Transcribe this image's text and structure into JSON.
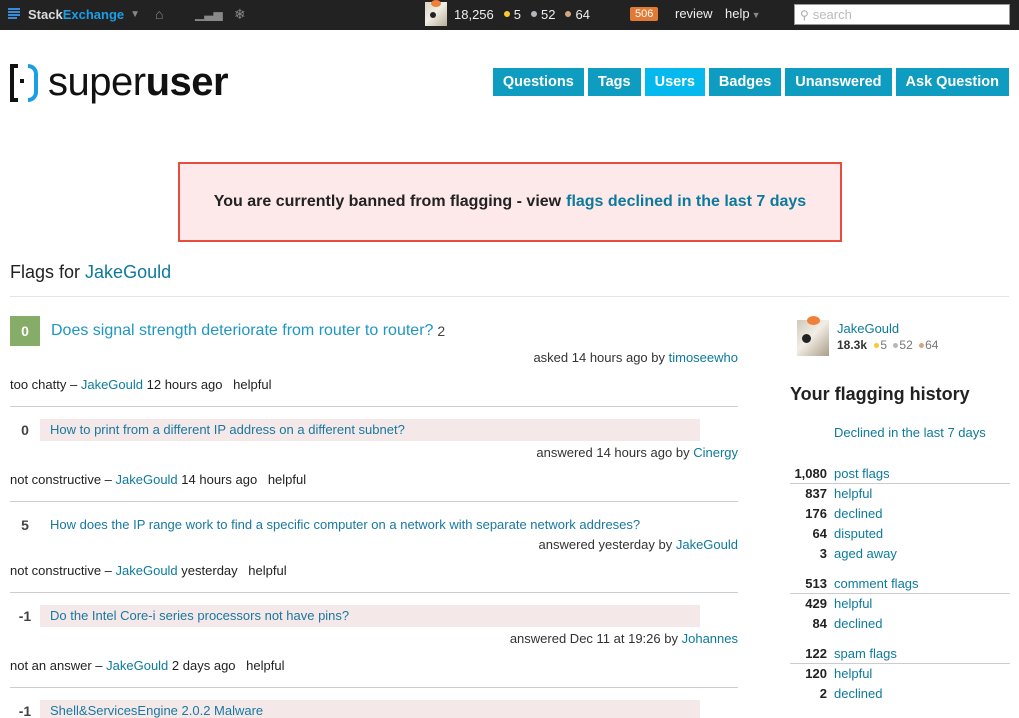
{
  "topbar": {
    "brand_stack": "Stack",
    "brand_exchange": "Exchange",
    "icons": [
      "inbox-icon",
      "achievements-icon",
      "hats-icon"
    ],
    "reputation": "18,256",
    "badges": {
      "gold": "5",
      "silver": "52",
      "bronze": "64"
    },
    "review_count": "506",
    "review_label": "review",
    "help_label": "help",
    "search_placeholder": "search"
  },
  "header": {
    "logo_light": "super",
    "logo_bold": "user",
    "nav": [
      {
        "label": "Questions",
        "active": false
      },
      {
        "label": "Tags",
        "active": false
      },
      {
        "label": "Users",
        "active": true
      },
      {
        "label": "Badges",
        "active": false
      },
      {
        "label": "Unanswered",
        "active": false
      },
      {
        "label": "Ask Question",
        "active": false
      }
    ]
  },
  "ban": {
    "text": "You are currently banned from flagging - view",
    "link": "flags declined in the last 7 days"
  },
  "flags": {
    "title_prefix": "Flags for",
    "user": "JakeGould",
    "items": [
      {
        "type": "question",
        "votes": "0",
        "title": "Does signal strength deteriorate from router to router?",
        "answer_count": "2",
        "byline_prefix": "asked 14 hours ago by",
        "byline_user": "timoseewho",
        "flag_reason": "too chatty –",
        "flagger": "JakeGould",
        "flag_time": "12 hours ago",
        "status": "helpful"
      },
      {
        "type": "answer",
        "votes": "0",
        "title": "How to print from a different IP address on a different subnet?",
        "byline_prefix": "answered 14 hours ago by",
        "byline_user": "Cinergy",
        "flag_reason": "not constructive –",
        "flagger": "JakeGould",
        "flag_time": "14 hours ago",
        "status": "helpful"
      },
      {
        "type": "answer",
        "votes": "5",
        "title": "How does the IP range work to find a specific computer on a network with separate network addreses?",
        "byline_prefix": "answered yesterday by",
        "byline_user": "JakeGould",
        "flag_reason": "not constructive –",
        "flagger": "JakeGould",
        "flag_time": "yesterday",
        "status": "helpful"
      },
      {
        "type": "answer",
        "votes": "-1",
        "title": "Do the Intel Core-i series processors not have pins?",
        "byline_prefix": "answered Dec 11 at 19:26 by",
        "byline_user": "Johannes",
        "flag_reason": "not an answer –",
        "flagger": "JakeGould",
        "flag_time": "2 days ago",
        "status": "helpful"
      },
      {
        "type": "answer",
        "votes": "-1",
        "title": "Shell&ServicesEngine 2.0.2 Malware"
      }
    ]
  },
  "sidebar": {
    "user": "JakeGould",
    "rep": "18.3k",
    "badges": {
      "gold": "5",
      "silver": "52",
      "bronze": "64"
    },
    "heading": "Your flagging history",
    "declined_link": "Declined in the last 7 days",
    "groups": [
      {
        "total": "1,080",
        "label": "post flags",
        "rows": [
          {
            "num": "837",
            "label": "helpful"
          },
          {
            "num": "176",
            "label": "declined"
          },
          {
            "num": "64",
            "label": "disputed"
          },
          {
            "num": "3",
            "label": "aged away"
          }
        ]
      },
      {
        "total": "513",
        "label": "comment flags",
        "rows": [
          {
            "num": "429",
            "label": "helpful"
          },
          {
            "num": "84",
            "label": "declined"
          }
        ]
      },
      {
        "total": "122",
        "label": "spam flags",
        "rows": [
          {
            "num": "120",
            "label": "helpful"
          },
          {
            "num": "2",
            "label": "declined"
          }
        ]
      }
    ]
  }
}
